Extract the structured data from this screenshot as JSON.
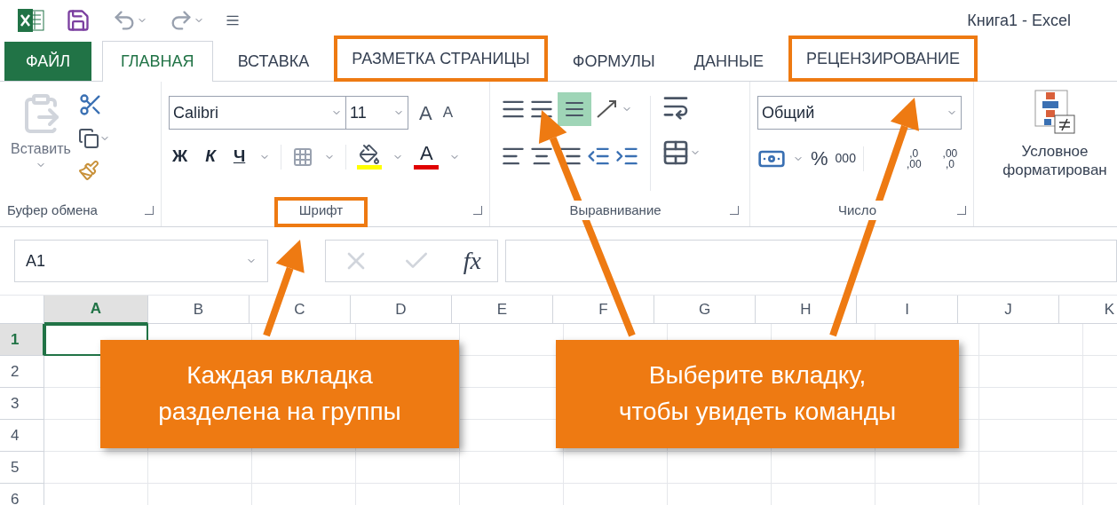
{
  "title_bar": {
    "title": "Книга1 - Excel"
  },
  "tabs": [
    {
      "label": "ФАЙЛ",
      "kind": "file",
      "selected": false,
      "highlighted": false
    },
    {
      "label": "ГЛАВНАЯ",
      "kind": "tab",
      "selected": true,
      "highlighted": false
    },
    {
      "label": "ВСТАВКА",
      "kind": "tab",
      "selected": false,
      "highlighted": false
    },
    {
      "label": "РАЗМЕТКА СТРАНИЦЫ",
      "kind": "tab",
      "selected": false,
      "highlighted": true
    },
    {
      "label": "ФОРМУЛЫ",
      "kind": "tab",
      "selected": false,
      "highlighted": false
    },
    {
      "label": "ДАННЫЕ",
      "kind": "tab",
      "selected": false,
      "highlighted": false
    },
    {
      "label": "РЕЦЕНЗИРОВАНИЕ",
      "kind": "tab",
      "selected": false,
      "highlighted": true
    }
  ],
  "ribbon": {
    "clipboard": {
      "paste_label": "Вставить",
      "group_label": "Буфер обмена",
      "group_highlighted": false
    },
    "font": {
      "font_name": "Calibri",
      "font_size": "11",
      "grow": "A",
      "shrink": "A",
      "bold": "Ж",
      "italic": "К",
      "underline": "Ч",
      "font_color": "A",
      "group_label": "Шрифт",
      "group_highlighted": true
    },
    "alignment": {
      "bottom_align_selected": true,
      "group_label": "Выравнивание",
      "group_highlighted": false
    },
    "number": {
      "format": "Общий",
      "percent": "%",
      "thousands": "000",
      "increase_decimal": [
        ",0",
        ",00"
      ],
      "decrease_decimal": [
        ",00",
        ",0"
      ],
      "group_label": "Число",
      "group_highlighted": false
    },
    "styles": {
      "conditional_label": "Условное форматирован"
    }
  },
  "formula_bar": {
    "name_box": "A1",
    "fx": "fx"
  },
  "sheet": {
    "columns": [
      {
        "label": "A",
        "selected": true
      },
      {
        "label": "B",
        "selected": false
      },
      {
        "label": "C",
        "selected": false
      },
      {
        "label": "D",
        "selected": false
      },
      {
        "label": "E",
        "selected": false
      },
      {
        "label": "F",
        "selected": false
      },
      {
        "label": "G",
        "selected": false
      },
      {
        "label": "H",
        "selected": false
      },
      {
        "label": "I",
        "selected": false
      },
      {
        "label": "J",
        "selected": false
      },
      {
        "label": "K",
        "selected": false
      }
    ],
    "rows": [
      {
        "label": "1",
        "selected": true
      },
      {
        "label": "2",
        "selected": false
      },
      {
        "label": "3",
        "selected": false
      },
      {
        "label": "4",
        "selected": false
      },
      {
        "label": "5",
        "selected": false
      },
      {
        "label": "6",
        "selected": false
      }
    ]
  },
  "callouts": [
    {
      "text": "Каждая вкладка\nразделена на группы"
    },
    {
      "text": "Выберите вкладку,\nчтобы увидеть команды"
    }
  ]
}
